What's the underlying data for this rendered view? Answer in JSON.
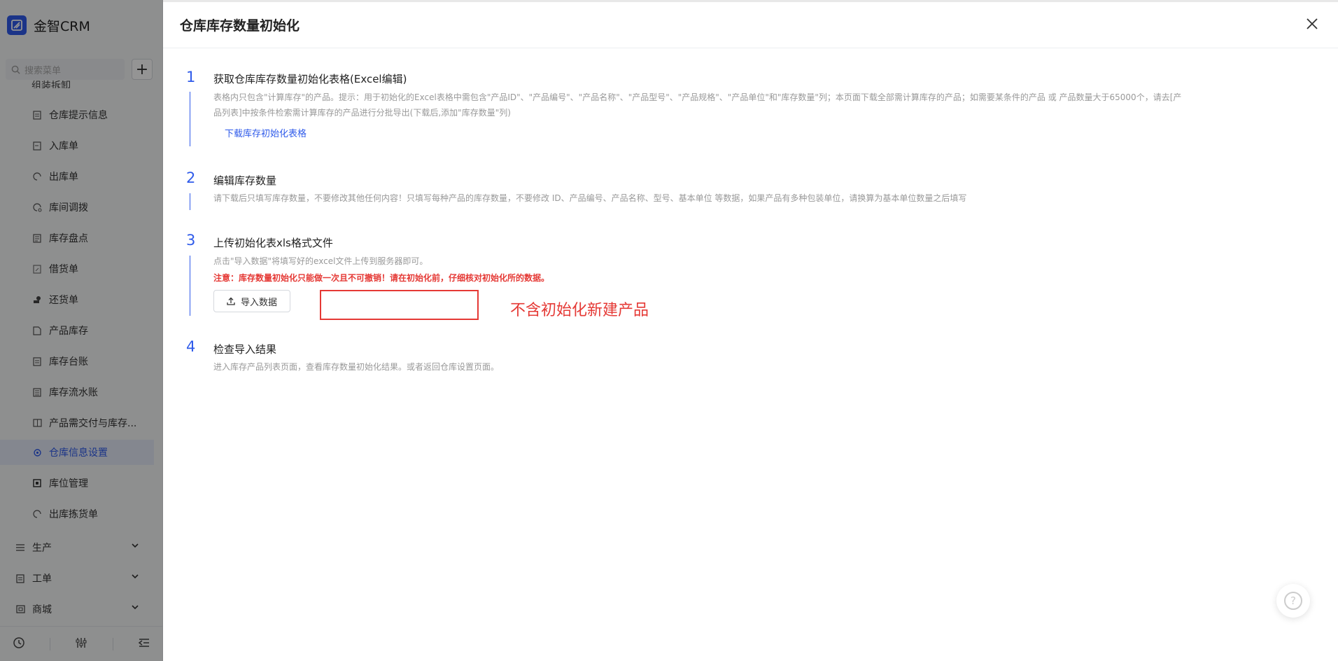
{
  "app": {
    "name": "金智CRM"
  },
  "sidebar": {
    "search_placeholder": "搜索菜单",
    "cut_item": "组装拆卸",
    "items": [
      {
        "label": "仓库提示信息",
        "icon": "list-icon"
      },
      {
        "label": "入库单",
        "icon": "inbound-icon"
      },
      {
        "label": "出库单",
        "icon": "outbound-icon"
      },
      {
        "label": "库间调拨",
        "icon": "transfer-icon"
      },
      {
        "label": "库存盘点",
        "icon": "inventory-check-icon"
      },
      {
        "label": "借货单",
        "icon": "borrow-icon"
      },
      {
        "label": "还货单",
        "icon": "return-icon"
      },
      {
        "label": "产品库存",
        "icon": "product-stock-icon"
      },
      {
        "label": "库存台账",
        "icon": "ledger-icon"
      },
      {
        "label": "库存流水账",
        "icon": "journal-icon"
      },
      {
        "label": "产品需交付与库存...",
        "icon": "compare-icon"
      },
      {
        "label": "仓库信息设置",
        "icon": "gear-icon",
        "active": true
      },
      {
        "label": "库位管理",
        "icon": "location-icon"
      },
      {
        "label": "出库拣货单",
        "icon": "picking-icon"
      }
    ],
    "groups": [
      {
        "label": "生产",
        "icon": "production-icon"
      },
      {
        "label": "工单",
        "icon": "work-order-icon"
      },
      {
        "label": "商城",
        "icon": "store-icon"
      }
    ]
  },
  "drawer": {
    "title": "仓库库存数量初始化",
    "steps": [
      {
        "num": "1",
        "title": "获取仓库库存数量初始化表格(Excel编辑)",
        "desc_line1": "表格内只包含\"计算库存\"的产品。提示：用于初始化的Excel表格中需包含\"产品ID\"、\"产品编号\"、\"产品名称\"、\"产品型号\"、\"产品规格\"、\"产品单位\"和\"库存数量\"列；本页面下载全部需计算库存的产品；如需要某条件的产品 或 产品数量大于65000个，请去[产",
        "desc_line2": "品列表]中按条件检索需计算库存的产品进行分批导出(下载后,添加\"库存数量\"列)",
        "link": "下载库存初始化表格"
      },
      {
        "num": "2",
        "title": "编辑库存数量",
        "desc_line1": "请下载后只填写库存数量，不要修改其他任何内容！只填写每种产品的库存数量，不要修改 ID、产品编号、产品名称、型号、基本单位 等数据，如果产品有多种包装单位，请换算为基本单位数量之后填写"
      },
      {
        "num": "3",
        "title": "上传初始化表xls格式文件",
        "desc_line1": "点击\"导入数据\"将填写好的excel文件上传到服务器即可。",
        "warning": "注意：库存数量初始化只能做一次且不可撤销！请在初始化前，仔细核对初始化所的数据。",
        "button": "导入数据"
      },
      {
        "num": "4",
        "title": "检查导入结果",
        "desc_line1": "进入库存产品列表页面，查看库存数量初始化结果。或者返回仓库设置页面。"
      }
    ],
    "annotation": "不含初始化新建产品"
  },
  "colors": {
    "accent": "#2f5bea",
    "warning": "#e53935"
  }
}
